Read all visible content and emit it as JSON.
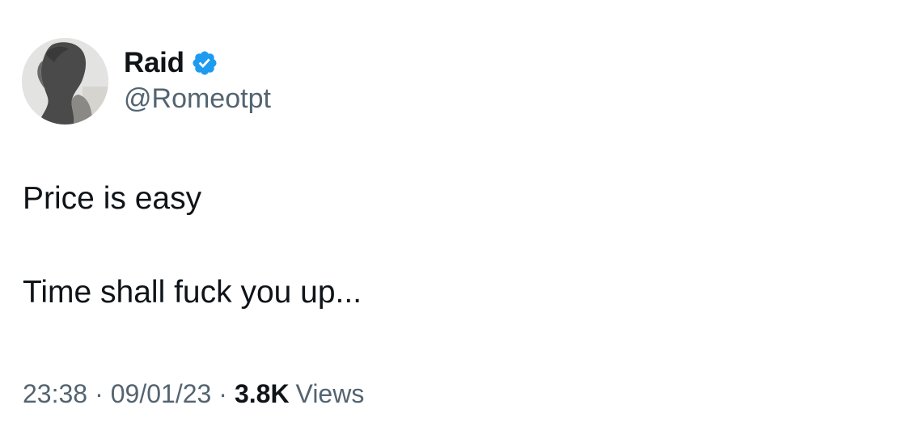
{
  "author": {
    "display_name": "Raid",
    "handle": "@Romeotpt",
    "verified": true,
    "verified_icon": "verified-badge-icon",
    "verified_color": "#1d9bf0",
    "avatar": "profile-photo-silhouette"
  },
  "tweet": {
    "lines": [
      "Price is easy",
      "Time shall fuck you up..."
    ],
    "time": "23:38",
    "separator": "·",
    "date": "09/01/23",
    "views_count": "3.8K",
    "views_label": "Views"
  },
  "colors": {
    "text_primary": "#0f1419",
    "text_secondary": "#536471",
    "background": "#ffffff"
  }
}
